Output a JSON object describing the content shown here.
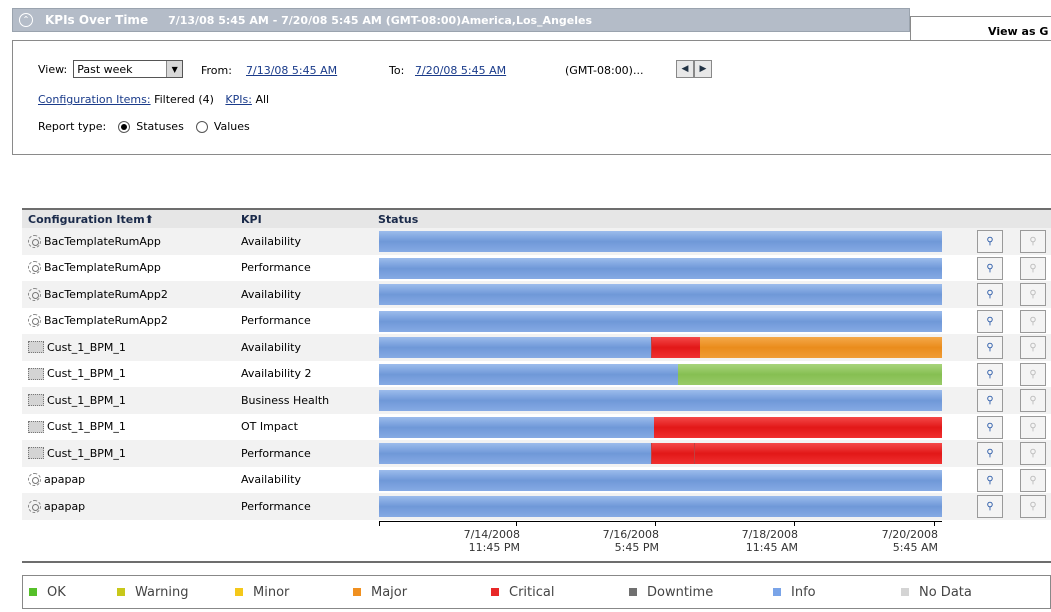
{
  "header": {
    "title": "KPIs Over Time",
    "range": "7/13/08 5:45 AM - 7/20/08 5:45 AM (GMT-08:00)America,Los_Angeles",
    "collapse_glyph": "»",
    "tab_label": "View as G"
  },
  "filters": {
    "view_label": "View:",
    "view_value": "Past week",
    "from_label": "From:",
    "from_value": "7/13/08 5:45 AM",
    "to_label": "To:",
    "to_value": "7/20/08 5:45 AM",
    "timezone": "(GMT-08:00)...",
    "ci_label": "Configuration Items:",
    "ci_value": "Filtered (4)",
    "kpis_label": "KPIs:",
    "kpis_value": "All",
    "report_type_label": "Report type:",
    "statuses_label": "Statuses",
    "values_label": "Values"
  },
  "table": {
    "col_ci": "Configuration Item⬆",
    "col_kpi": "KPI",
    "col_status": "Status",
    "rows": [
      {
        "ci": "BacTemplateRumApp",
        "kpi": "Availability",
        "icon": "gear-icon"
      },
      {
        "ci": "BacTemplateRumApp",
        "kpi": "Performance",
        "icon": "gear-icon"
      },
      {
        "ci": "BacTemplateRumApp2",
        "kpi": "Availability",
        "icon": "gear-icon"
      },
      {
        "ci": "BacTemplateRumApp2",
        "kpi": "Performance",
        "icon": "gear-icon"
      },
      {
        "ci": "Cust_1_BPM_1",
        "kpi": "Availability",
        "icon": "bpm-icon"
      },
      {
        "ci": "Cust_1_BPM_1",
        "kpi": "Availability 2",
        "icon": "bpm-icon"
      },
      {
        "ci": "Cust_1_BPM_1",
        "kpi": "Business Health",
        "icon": "bpm-icon"
      },
      {
        "ci": "Cust_1_BPM_1",
        "kpi": "OT Impact",
        "icon": "bpm-icon"
      },
      {
        "ci": "Cust_1_BPM_1",
        "kpi": "Performance",
        "icon": "bpm-icon"
      },
      {
        "ci": "apapap",
        "kpi": "Availability",
        "icon": "gear-icon"
      },
      {
        "ci": "apapap",
        "kpi": "Performance",
        "icon": "gear-icon"
      }
    ]
  },
  "axis": {
    "ticks": [
      {
        "date": "7/14/2008",
        "time": "11:45 PM"
      },
      {
        "date": "7/16/2008",
        "time": "5:45 PM"
      },
      {
        "date": "7/18/2008",
        "time": "11:45 AM"
      },
      {
        "date": "7/20/2008",
        "time": "5:45 AM"
      }
    ]
  },
  "legend": [
    {
      "label": "OK",
      "color": "#56c02a"
    },
    {
      "label": "Warning",
      "color": "#c8c81a"
    },
    {
      "label": "Minor",
      "color": "#f4c81a"
    },
    {
      "label": "Major",
      "color": "#f09020"
    },
    {
      "label": "Critical",
      "color": "#e82828"
    },
    {
      "label": "Downtime",
      "color": "#707070"
    },
    {
      "label": "Info",
      "color": "#7aa4e8"
    },
    {
      "label": "No Data",
      "color": "#d4d4d4"
    }
  ]
}
